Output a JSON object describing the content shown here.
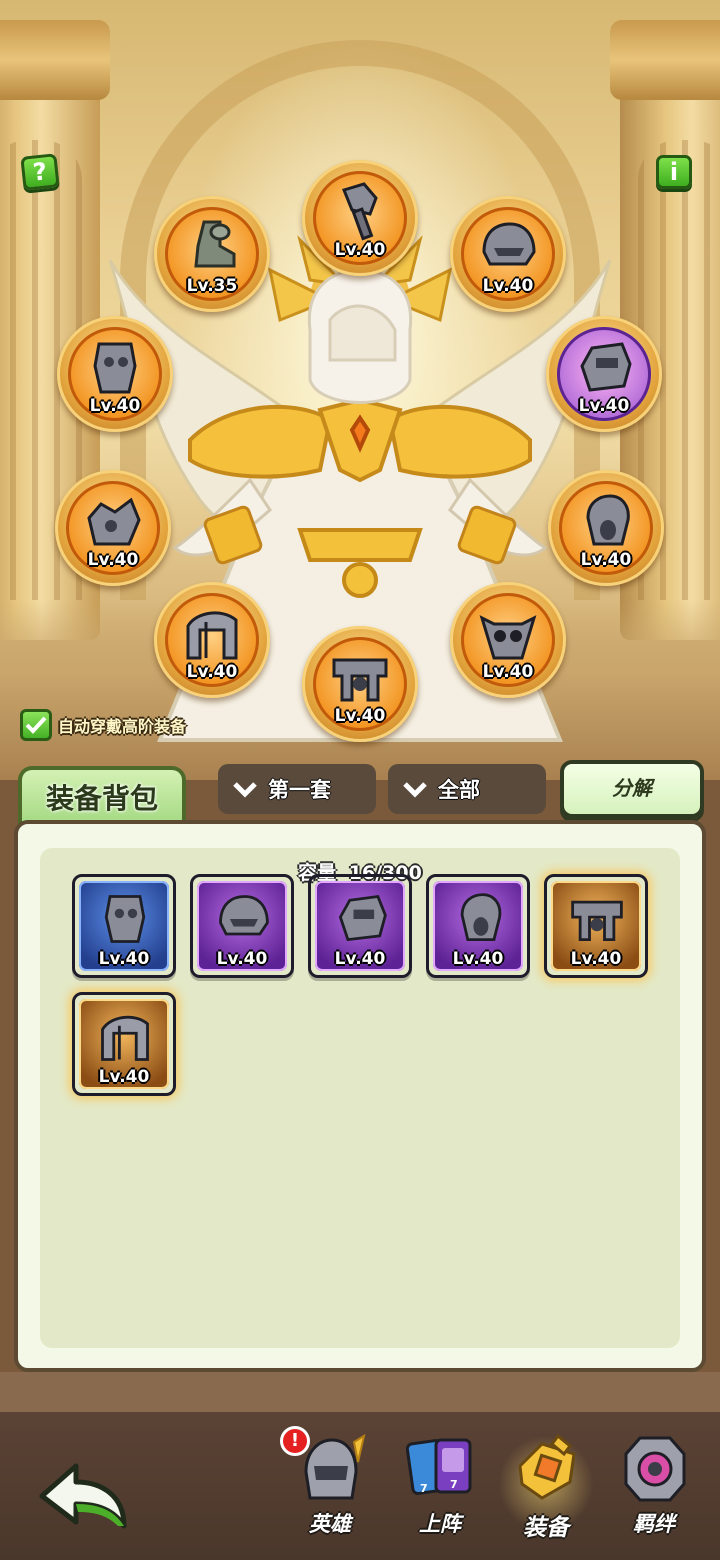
{
  "top_controls": {
    "help_icon": "?",
    "info_icon": "i"
  },
  "equipped_slots": [
    {
      "name": "boots",
      "level": "Lv.35",
      "frame": "orange",
      "icon": "boot-icon"
    },
    {
      "name": "hammer",
      "level": "Lv.40",
      "frame": "orange",
      "icon": "hammer-icon"
    },
    {
      "name": "helmet",
      "level": "Lv.40",
      "frame": "orange",
      "icon": "helmet-icon"
    },
    {
      "name": "armor",
      "level": "Lv.40",
      "frame": "orange",
      "icon": "armor-icon"
    },
    {
      "name": "gauntlet",
      "level": "Lv.40",
      "frame": "purple",
      "icon": "gauntlet-icon"
    },
    {
      "name": "shoulder",
      "level": "Lv.40",
      "frame": "orange",
      "icon": "shoulder-icon"
    },
    {
      "name": "ring",
      "level": "Lv.40",
      "frame": "orange",
      "icon": "ring-icon"
    },
    {
      "name": "pauldron",
      "level": "Lv.40",
      "frame": "orange",
      "icon": "pauldron-icon"
    },
    {
      "name": "skull",
      "level": "Lv.40",
      "frame": "orange",
      "icon": "skull-mask-icon"
    },
    {
      "name": "belt",
      "level": "Lv.40",
      "frame": "orange",
      "icon": "belt-icon"
    }
  ],
  "auto_equip": {
    "label": "自动穿戴高阶装备",
    "checked": true
  },
  "bag": {
    "title": "装备背包",
    "filter_set": "第一套",
    "filter_all": "全部",
    "decompose": "分解",
    "capacity_label": "容量",
    "capacity_value": "16/300",
    "items": [
      {
        "level": "Lv.40",
        "rarity": "blue",
        "icon": "armor-icon"
      },
      {
        "level": "Lv.40",
        "rarity": "purple",
        "icon": "helmet-icon"
      },
      {
        "level": "Lv.40",
        "rarity": "purple",
        "icon": "gauntlet-icon"
      },
      {
        "level": "Lv.40",
        "rarity": "purple",
        "icon": "ring-icon"
      },
      {
        "level": "Lv.40",
        "rarity": "gold",
        "icon": "belt-icon"
      },
      {
        "level": "Lv.40",
        "rarity": "gold",
        "icon": "pauldron-icon"
      }
    ]
  },
  "nav": {
    "back_icon": "back-arrow-icon",
    "tabs": [
      {
        "label": "英雄",
        "icon": "knight-helmet-icon",
        "badge": "!",
        "active": false
      },
      {
        "label": "上阵",
        "icon": "cards-icon",
        "card_counts": [
          "7",
          "7"
        ],
        "active": false
      },
      {
        "label": "装备",
        "icon": "equipment-icon",
        "active": true
      },
      {
        "label": "羁绊",
        "icon": "bond-icon",
        "active": false
      }
    ]
  },
  "colors": {
    "bag_tab": "#9fd77d",
    "rarity_blue": "#243f8e",
    "rarity_purple": "#5d2295",
    "rarity_gold": "#8b4d14",
    "slot_orange": "#f2931f",
    "nav_bg": "#4a372b"
  }
}
